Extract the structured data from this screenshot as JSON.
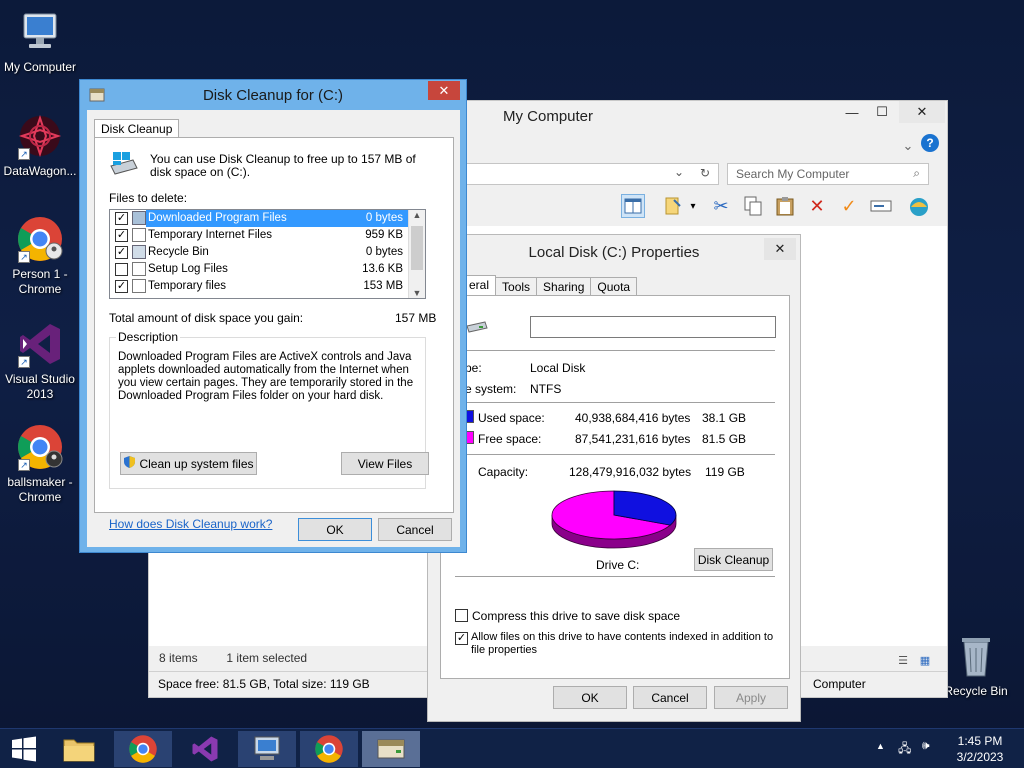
{
  "desktop": {
    "icons": [
      {
        "label": "My Computer"
      },
      {
        "label": "DataWagon..."
      },
      {
        "label": "Person 1 - Chrome"
      },
      {
        "label": "Visual Studio 2013"
      },
      {
        "label": "ballsmaker - Chrome"
      },
      {
        "label": "Recycle Bin"
      }
    ]
  },
  "explorer": {
    "title": "My Computer",
    "search_placeholder": "Search My Computer",
    "status_items": "8 items",
    "status_selected": "1 item selected",
    "details": "Space free: 81.5 GB, Total size: 119 GB",
    "details_right": "Computer"
  },
  "props": {
    "title": "Local Disk (C:) Properties",
    "tabs": [
      "eral",
      "Tools",
      "Sharing",
      "Quota"
    ],
    "type_label": "pe:",
    "type_value": "Local Disk",
    "fs_label": "e system:",
    "fs_value": "NTFS",
    "used_label": "Used space:",
    "used_bytes": "40,938,684,416 bytes",
    "used_gb": "38.1 GB",
    "free_label": "Free space:",
    "free_bytes": "87,541,231,616 bytes",
    "free_gb": "81.5 GB",
    "capacity_label": "Capacity:",
    "capacity_bytes": "128,479,916,032 bytes",
    "capacity_gb": "119 GB",
    "drive_label": "Drive C:",
    "disk_cleanup_btn": "Disk Cleanup",
    "compress_label": "Compress this drive to save disk space",
    "index_label": "Allow files on this drive to have contents indexed in addition to file properties",
    "ok": "OK",
    "cancel": "Cancel",
    "apply": "Apply",
    "used_fraction": 0.319,
    "colors": {
      "used": "#1010e0",
      "free": "#ff00ff"
    }
  },
  "cleanup": {
    "title": "Disk Cleanup for  (C:)",
    "tab": "Disk Cleanup",
    "intro": "You can use Disk Cleanup to free up to 157 MB of disk space on  (C:).",
    "files_label": "Files to delete:",
    "files": [
      {
        "name": "Downloaded Program Files",
        "size": "0 bytes",
        "checked": true,
        "selected": true
      },
      {
        "name": "Temporary Internet Files",
        "size": "959 KB",
        "checked": true,
        "selected": false
      },
      {
        "name": "Recycle Bin",
        "size": "0 bytes",
        "checked": true,
        "selected": false
      },
      {
        "name": "Setup Log Files",
        "size": "13.6 KB",
        "checked": false,
        "selected": false
      },
      {
        "name": "Temporary files",
        "size": "153 MB",
        "checked": true,
        "selected": false
      }
    ],
    "total_label": "Total amount of disk space you gain:",
    "total_value": "157 MB",
    "description_label": "Description",
    "description": "Downloaded Program Files are ActiveX controls and Java applets downloaded automatically from the Internet when you view certain pages. They are temporarily stored in the Downloaded Program Files folder on your hard disk.",
    "cleanup_system_btn": "Clean up system files",
    "view_files_btn": "View Files",
    "help_link": "How does Disk Cleanup work?",
    "ok": "OK",
    "cancel": "Cancel"
  },
  "taskbar": {
    "time": "1:45 PM",
    "date": "3/2/2023"
  }
}
